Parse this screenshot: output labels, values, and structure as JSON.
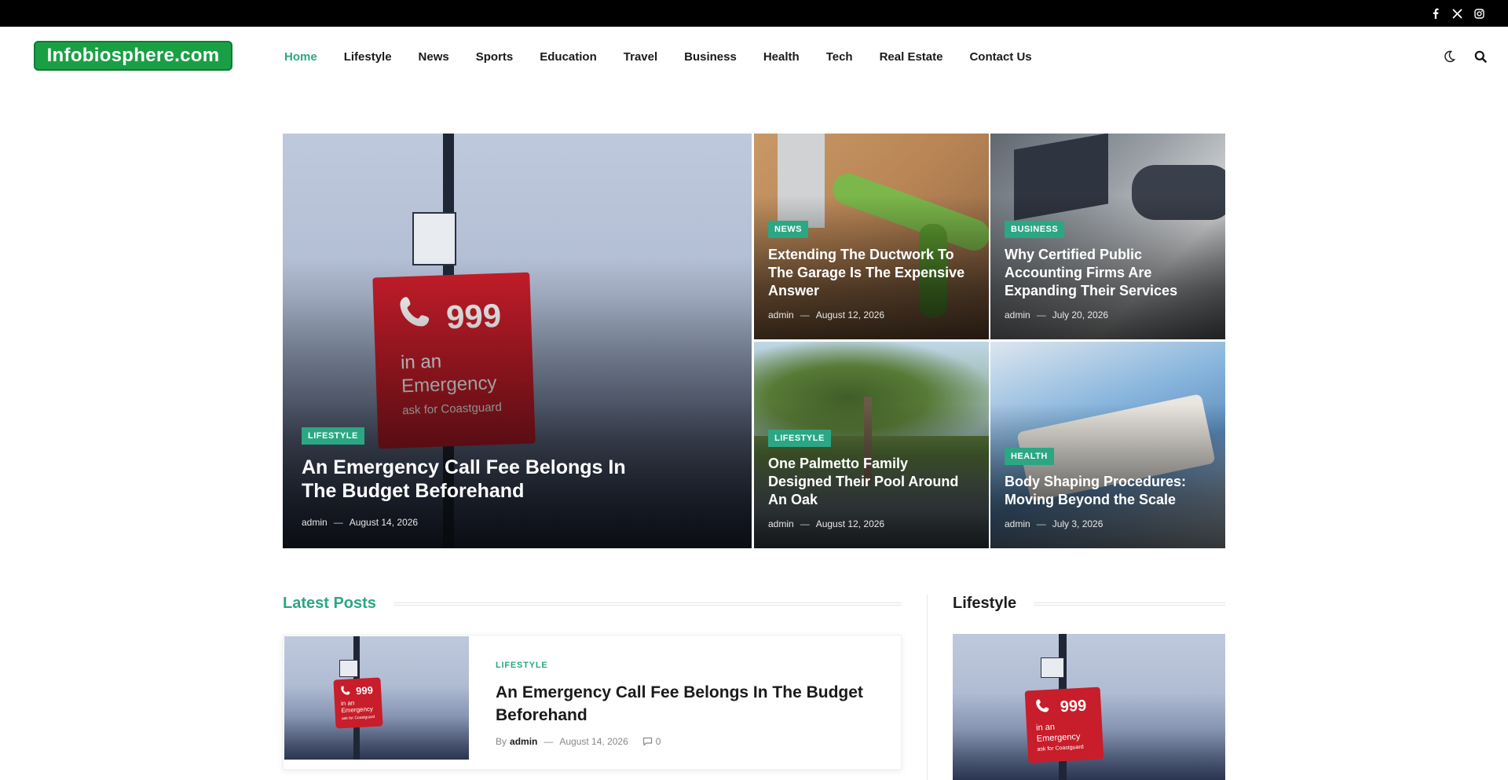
{
  "topbar": {
    "social": [
      {
        "icon": "facebook-icon",
        "glyph": "f"
      },
      {
        "icon": "x-icon",
        "glyph": "𝕏"
      },
      {
        "icon": "instagram-icon",
        "glyph": "◎"
      }
    ]
  },
  "header": {
    "logo_text": "Infobiosphere.com",
    "nav": [
      "Home",
      "Lifestyle",
      "News",
      "Sports",
      "Education",
      "Travel",
      "Business",
      "Health",
      "Tech",
      "Real Estate",
      "Contact Us"
    ],
    "active_nav": "Home",
    "tools": {
      "theme_icon": "moon-icon",
      "search_icon": "search-icon"
    }
  },
  "colors": {
    "accent": "#2ba783",
    "logo_bg": "#1a9f45",
    "topbar": "#000000"
  },
  "hero": {
    "main": {
      "category": "LIFESTYLE",
      "title": "An Emergency Call Fee Belongs In The Budget Beforehand",
      "author": "admin",
      "date": "August 14, 2026",
      "image_text": {
        "number": "999",
        "line1": "in an",
        "line2": "Emergency",
        "line3": "ask for Coastguard"
      }
    },
    "grid": [
      {
        "category": "NEWS",
        "title": "Extending The Ductwork To The Garage Is The Expensive Answer",
        "author": "admin",
        "date": "August 12, 2026"
      },
      {
        "category": "BUSINESS",
        "title": "Why Certified Public Accounting Firms Are Expanding Their Services",
        "author": "admin",
        "date": "July 20, 2026"
      },
      {
        "category": "LIFESTYLE",
        "title": "One Palmetto Family Designed Their Pool Around An Oak",
        "author": "admin",
        "date": "August 12, 2026"
      },
      {
        "category": "HEALTH",
        "title": "Body Shaping Procedures: Moving Beyond the Scale",
        "author": "admin",
        "date": "July 3, 2026"
      }
    ],
    "meta_sep": "—"
  },
  "latest": {
    "heading": "Latest Posts",
    "post": {
      "category": "LIFESTYLE",
      "title": "An Emergency Call Fee Belongs In The Budget Beforehand",
      "by": "By",
      "author": "admin",
      "date": "August 14, 2026",
      "comments": "0"
    }
  },
  "sidebar": {
    "heading": "Lifestyle"
  }
}
